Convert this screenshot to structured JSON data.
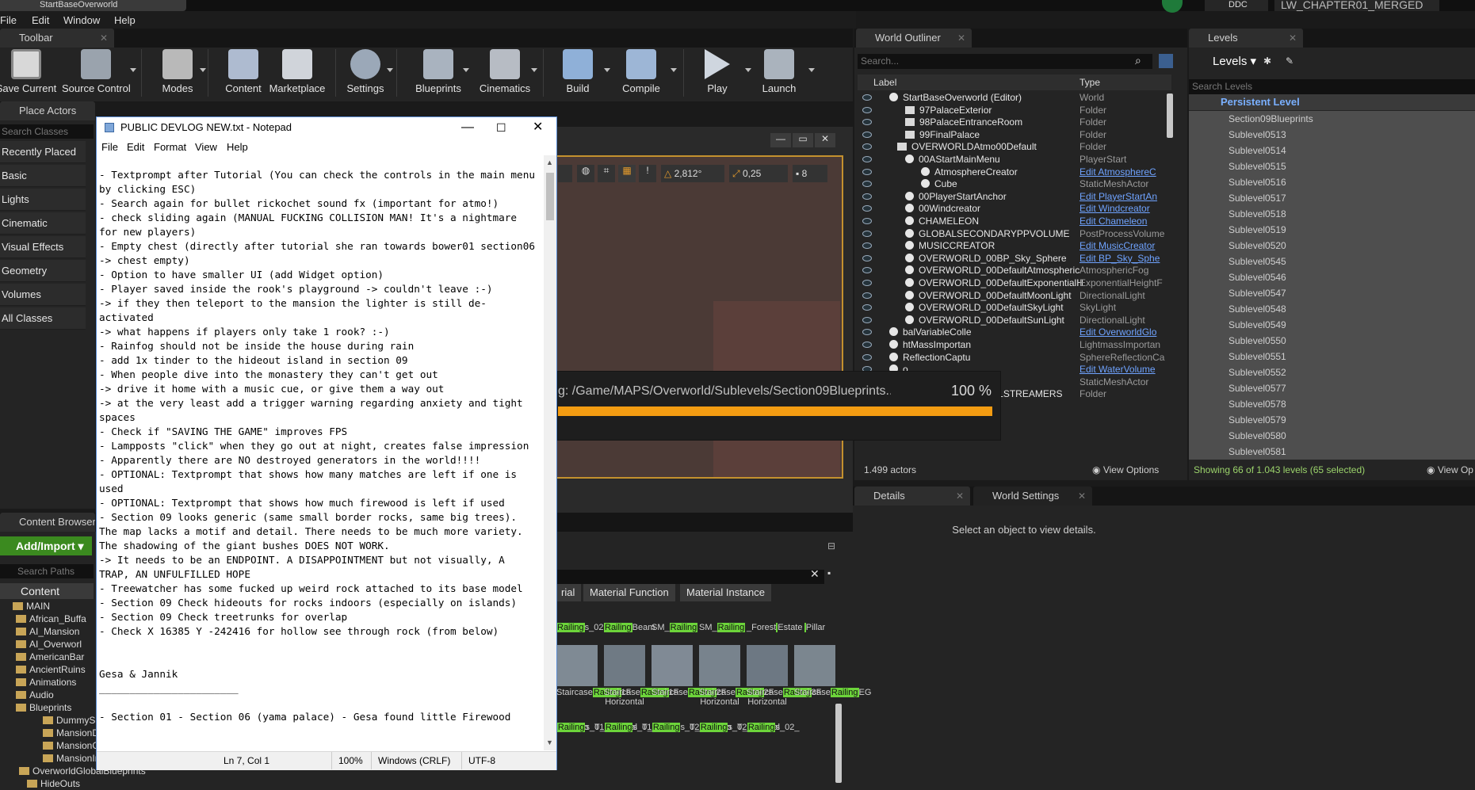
{
  "window": {
    "title": "StartBaseOverworld",
    "ddc": "DDC",
    "project": "LW_CHAPTER01_MERGED"
  },
  "menu": [
    "File",
    "Edit",
    "Window",
    "Help"
  ],
  "toolbar": {
    "tab": "Toolbar",
    "buttons": [
      "Save Current",
      "Source Control",
      "Modes",
      "Content",
      "Marketplace",
      "Settings",
      "Blueprints",
      "Cinematics",
      "Build",
      "Compile",
      "Play",
      "Launch"
    ]
  },
  "place_actors": {
    "tab": "Place Actors",
    "search_placeholder": "Search Classes",
    "items": [
      "Recently Placed",
      "Basic",
      "Lights",
      "Cinematic",
      "Visual Effects",
      "Geometry",
      "Volumes",
      "All Classes"
    ]
  },
  "viewport": {
    "angle": "2,812°",
    "scale": "0,25",
    "speed": "8"
  },
  "outliner": {
    "tab": "World Outliner",
    "search_placeholder": "Search...",
    "col_label": "Label",
    "col_type": "Type",
    "rows": [
      {
        "label": "StartBaseOverworld (Editor)",
        "type": "World"
      },
      {
        "label": "97PalaceExterior",
        "type": "Folder"
      },
      {
        "label": "98PalaceEntranceRoom",
        "type": "Folder"
      },
      {
        "label": "99FinalPalace",
        "type": "Folder"
      },
      {
        "label": "OVERWORLDAtmo00Default",
        "type": "Folder"
      },
      {
        "label": "00AStartMainMenu",
        "type": "PlayerStart"
      },
      {
        "label": "AtmosphereCreator",
        "type": "Edit AtmosphereC"
      },
      {
        "label": "Cube",
        "type": "StaticMeshActor"
      },
      {
        "label": "00PlayerStartAnchor",
        "type": "Edit PlayerStartAn"
      },
      {
        "label": "00Windcreator",
        "type": "Edit Windcreator"
      },
      {
        "label": "CHAMELEON",
        "type": "Edit Chameleon"
      },
      {
        "label": "GLOBALSECONDARYPPVOLUME",
        "type": "PostProcessVolume"
      },
      {
        "label": "MUSICCREATOR",
        "type": "Edit MusicCreator"
      },
      {
        "label": "OVERWORLD_00BP_Sky_Sphere",
        "type": "Edit BP_Sky_Sphe"
      },
      {
        "label": "OVERWORLD_00DefaultAtmospheric",
        "type": "AtmosphericFog"
      },
      {
        "label": "OVERWORLD_00DefaultExponentialH",
        "type": "ExponentialHeightF"
      },
      {
        "label": "OVERWORLD_00DefaultMoonLight",
        "type": "DirectionalLight"
      },
      {
        "label": "OVERWORLD_00DefaultSkyLight",
        "type": "SkyLight"
      },
      {
        "label": "OVERWORLD_00DefaultSunLight",
        "type": "DirectionalLight"
      },
      {
        "label": "balVariableColle",
        "type": "Edit OverworldGlo"
      },
      {
        "label": "htMassImportan",
        "type": "LightmassImportan"
      },
      {
        "label": "ReflectionCaptu",
        "type": "SphereReflectionCa"
      },
      {
        "label": "o",
        "type": "Edit WaterVolume"
      },
      {
        "label": "",
        "type": "StaticMeshActor"
      },
      {
        "label": "OVERWORLDLEVELSTREAMERS",
        "type": "Folder"
      }
    ],
    "actors": "1.499 actors",
    "view_options": "View Options"
  },
  "levels": {
    "tab": "Levels",
    "title": "Levels",
    "search_placeholder": "Search Levels",
    "persistent": "Persistent Level",
    "items": [
      "Section09Blueprints",
      "Sublevel0513",
      "Sublevel0514",
      "Sublevel0515",
      "Sublevel0516",
      "Sublevel0517",
      "Sublevel0518",
      "Sublevel0519",
      "Sublevel0520",
      "Sublevel0545",
      "Sublevel0546",
      "Sublevel0547",
      "Sublevel0548",
      "Sublevel0549",
      "Sublevel0550",
      "Sublevel0551",
      "Sublevel0552",
      "Sublevel0577",
      "Sublevel0578",
      "Sublevel0579",
      "Sublevel0580",
      "Sublevel0581"
    ],
    "status": "Showing 66 of 1.043 levels (65 selected)",
    "view_options": "View Op"
  },
  "details": {
    "tab": "Details",
    "tab2": "World Settings",
    "empty": "Select an object to view details."
  },
  "content_browser": {
    "tab": "Content Browser",
    "add_import": "Add/Import",
    "search_paths": "Search Paths",
    "root": "Content",
    "folders": [
      "MAIN",
      "African_Buffa",
      "AI_Mansion",
      "AI_Overworl",
      "AmericanBar",
      "AncientRuins",
      "Animations",
      "Audio",
      "Blueprints",
      "DummySpa",
      "MansionDe",
      "MansionGlo",
      "MansionInt",
      "OverworldGlobalBlueprints",
      "HideOuts"
    ],
    "filters": [
      "rial",
      "Material Function",
      "Material Instance"
    ],
    "assets_row1": [
      {
        "a": "",
        "b": "Railing",
        "c": "s_02"
      },
      {
        "a": "",
        "b": "Railing",
        "c": "Beam"
      },
      {
        "a": "SM_",
        "b": "Railing",
        "c": ""
      },
      {
        "a": "SM_",
        "b": "Railing",
        "c": ""
      },
      {
        "a": "_Forest",
        "b": "",
        "c": "Estate"
      },
      {
        "a": "",
        "b": "",
        "c": "Pillar"
      }
    ],
    "assets_row2": [
      {
        "a": "Staircase",
        "b": "Railing",
        "c": "1F"
      },
      {
        "a": "Staircase",
        "b": "Railing",
        "c": "1F Horizontal"
      },
      {
        "a": "Staircase",
        "b": "Railing",
        "c": "2F"
      },
      {
        "a": "Staircase",
        "b": "Railing",
        "c": "2F Horizontal"
      },
      {
        "a": "Staircase",
        "b": "Railing",
        "c": "3F Horizontal"
      },
      {
        "a": "Staircase",
        "b": "Railing",
        "c": "EG"
      }
    ],
    "assets_row3": [
      {
        "a": "T_",
        "b": "Railing",
        "c": "_M"
      },
      {
        "a": "T_",
        "b": "Railing",
        "c": "_M"
      },
      {
        "a": "T_",
        "b": "Railing",
        "c": "_M"
      },
      {
        "a": "T_",
        "b": "Railing",
        "c": "_N"
      },
      {
        "a": "T_",
        "b": "Railing",
        "c": "_N"
      },
      {
        "a": "T_",
        "b": "Railing",
        "c": "_N"
      },
      {
        "a": "T_",
        "b": "Railing",
        "c": "s_01_Albedo"
      },
      {
        "a": "T_",
        "b": "Railing",
        "c": "s_01_Normal"
      },
      {
        "a": "T_",
        "b": "Railing",
        "c": "s_01_"
      },
      {
        "a": "T_",
        "b": "Railing",
        "c": "s_02_Albedo"
      },
      {
        "a": "T_",
        "b": "Railing",
        "c": "s_02_Normal"
      },
      {
        "a": "T_",
        "b": "Railing",
        "c": "s_02_"
      }
    ]
  },
  "progress": {
    "text": "g: /Game/MAPS/Overworld/Sublevels/Section09Blueprints...",
    "percent_label": "100 %",
    "value": 1.0
  },
  "notepad": {
    "title": "PUBLIC DEVLOG NEW.txt - Notepad",
    "menu": [
      "File",
      "Edit",
      "Format",
      "View",
      "Help"
    ],
    "text": "- Textprompt after Tutorial (You can check the controls in the main menu by clicking ESC)\n- Search again for bullet rickochet sound fx (important for atmo!)\n- check sliding again (MANUAL FUCKING COLLISION MAN! It's a nightmare for new players)\n- Empty chest (directly after tutorial she ran towards bower01 section06 -> chest empty)\n- Option to have smaller UI (add Widget option)\n- Player saved inside the rook's playground -> couldn't leave :-)\n-> if they then teleport to the mansion the lighter is still de-activated\n-> what happens if players only take 1 rook? :-)\n- Rainfog should not be inside the house during rain\n- add 1x tinder to the hideout island in section 09\n- When people dive into the monastery they can't get out\n-> drive it home with a music cue, or give them a way out\n-> at the very least add a trigger warning regarding anxiety and tight spaces\n- Check if \"SAVING THE GAME\" improves FPS\n- Lampposts \"click\" when they go out at night, creates false impression\n- Apparently there are NO destroyed generators in the world!!!!\n- OPTIONAL: Textprompt that shows how many matches are left if one is used\n- OPTIONAL: Textprompt that shows how much firewood is left if used\n- Section 09 looks generic (same small border rocks, same big trees). The map lacks a motif and detail. There needs to be much more variety. The shadowing of the giant bushes DOES NOT WORK.\n-> It needs to be an ENDPOINT. A DISAPPOINTMENT but not visually, A TRAP, AN UNFULFILLED HOPE\n- Treewatcher has some fucked up weird rock attached to its base model\n- Section 09 Check hideouts for rocks indoors (especially on islands)\n- Section 09 Check treetrunks for overlap\n- Check X 16385 Y -242416 for hollow see through rock (from below)\n\n\nGesa & Jannik\n_______________________\n\n- Section 01 - Section 06 (yama palace) - Gesa found little Firewood",
    "status": {
      "pos": "Ln 7, Col 1",
      "zoom": "100%",
      "eol": "Windows (CRLF)",
      "enc": "UTF-8"
    }
  },
  "colors": {
    "accent_orange": "#f39c12",
    "selection_blue": "#6fa3ff",
    "highlight_green": "#6cd43a"
  }
}
